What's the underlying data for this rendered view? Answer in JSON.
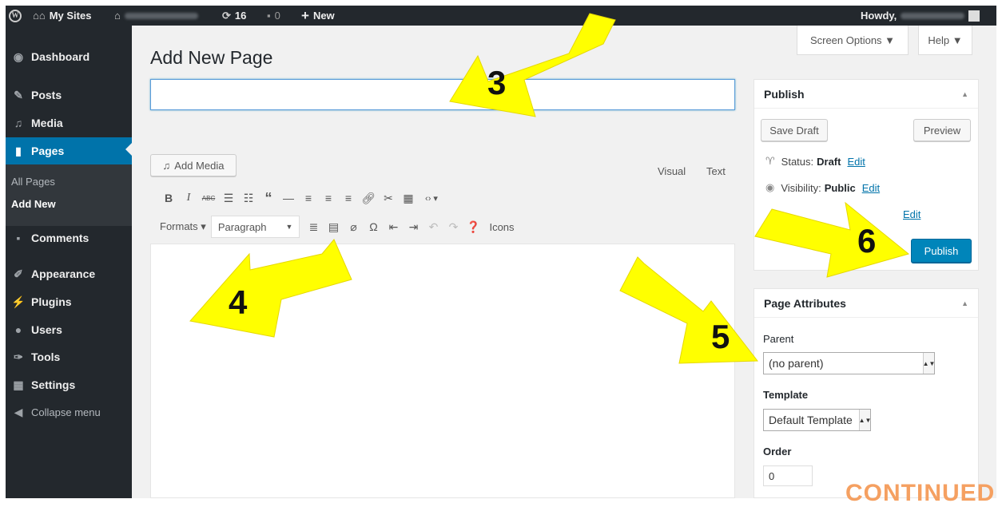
{
  "adminbar": {
    "my_sites": "My Sites",
    "updates_count": "16",
    "comments_count": "0",
    "new_label": "New",
    "howdy": "Howdy,"
  },
  "sidebar": {
    "items": [
      {
        "label": "Dashboard",
        "icon": "dashboard-icon"
      },
      {
        "label": "Posts",
        "icon": "pin-icon"
      },
      {
        "label": "Media",
        "icon": "media-icon"
      },
      {
        "label": "Pages",
        "icon": "pages-icon"
      },
      {
        "label": "Comments",
        "icon": "comment-icon"
      },
      {
        "label": "Appearance",
        "icon": "brush-icon"
      },
      {
        "label": "Plugins",
        "icon": "plug-icon"
      },
      {
        "label": "Users",
        "icon": "users-icon"
      },
      {
        "label": "Tools",
        "icon": "wrench-icon"
      },
      {
        "label": "Settings",
        "icon": "settings-icon"
      }
    ],
    "submenu": [
      "All Pages",
      "Add New"
    ],
    "collapse": "Collapse menu"
  },
  "header": {
    "title": "Add New Page",
    "screen_options": "Screen Options ▼",
    "help": "Help ▼"
  },
  "editor": {
    "title_value": "",
    "add_media": "Add Media",
    "tab_visual": "Visual",
    "tab_text": "Text",
    "formats": "Formats ▾",
    "paragraph": "Paragraph",
    "icons_label": "Icons"
  },
  "publish_box": {
    "title": "Publish",
    "save_draft": "Save Draft",
    "preview": "Preview",
    "status_label": "Status:",
    "status_value": "Draft",
    "visibility_label": "Visibility:",
    "visibility_value": "Public",
    "edit": "Edit",
    "publish": "Publish"
  },
  "attributes_box": {
    "title": "Page Attributes",
    "parent_label": "Parent",
    "parent_value": "(no parent)",
    "template_label": "Template",
    "template_value": "Default Template",
    "order_label": "Order",
    "order_value": "0"
  },
  "annotations": {
    "step3": "3",
    "step4": "4",
    "step5": "5",
    "step6": "6",
    "continued": "CONTINUED",
    "arrow_color": "#ffff00"
  },
  "colors": {
    "admin_dark": "#23282d",
    "accent": "#0073aa",
    "publish_blue": "#0085ba"
  }
}
